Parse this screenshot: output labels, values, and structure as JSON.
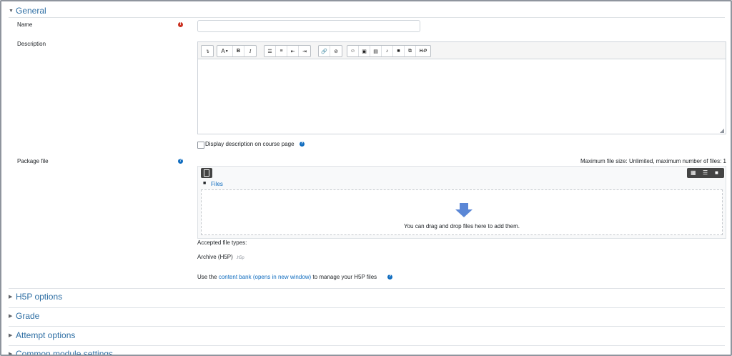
{
  "sections": {
    "general": {
      "title": "General"
    },
    "h5p_options": {
      "title": "H5P options"
    },
    "grade": {
      "title": "Grade"
    },
    "attempt_options": {
      "title": "Attempt options"
    },
    "common_module": {
      "title": "Common module settings"
    }
  },
  "form": {
    "name": {
      "label": "Name",
      "value": ""
    },
    "description": {
      "label": "Description",
      "value": ""
    },
    "display_description": {
      "label": "Display description on course page",
      "checked": false
    },
    "package_file": {
      "label": "Package file",
      "limits": "Maximum file size: Unlimited, maximum number of files: 1",
      "breadcrumb": "Files",
      "drop_text": "You can drag and drop files here to add them.",
      "accepted_heading": "Accepted file types:",
      "accepted_type": "Archive (H5P)",
      "accepted_ext": ".h5p",
      "content_bank_prefix": "Use the",
      "content_bank_link": "content bank (opens in new window)",
      "content_bank_suffix": "to manage your H5P files"
    }
  },
  "toolbar": {
    "buttons": [
      "toggle",
      "font",
      "bold",
      "italic",
      "unordered-list",
      "ordered-list",
      "outdent",
      "indent",
      "link",
      "unlink",
      "emoji",
      "image",
      "media",
      "record-audio",
      "record-video",
      "manage-files",
      "h5p"
    ],
    "font_label": "A",
    "bold_label": "B",
    "italic_label": "I",
    "h5p_label": "H-P"
  },
  "icons": {
    "required": "exclamation-icon",
    "help": "question-icon"
  },
  "colors": {
    "accent": "#0f6cbf",
    "required": "#ca3120",
    "drop_arrow": "#5b87d6"
  }
}
